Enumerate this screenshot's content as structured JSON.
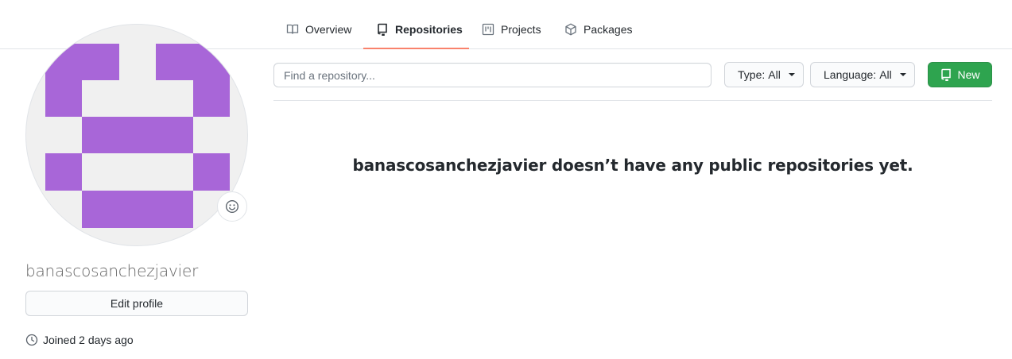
{
  "tabs": [
    {
      "label": "Overview",
      "icon": "book-icon",
      "selected": false
    },
    {
      "label": "Repositories",
      "icon": "repo-icon",
      "selected": true
    },
    {
      "label": "Projects",
      "icon": "project-icon",
      "selected": false
    },
    {
      "label": "Packages",
      "icon": "package-icon",
      "selected": false
    }
  ],
  "profile": {
    "username": "banascosanchezjavier",
    "edit_label": "Edit profile",
    "joined": "Joined 2 days ago",
    "avatar_color": "#a866d8"
  },
  "filters": {
    "search_placeholder": "Find a repository...",
    "type_prefix": "Type:",
    "type_value": "All",
    "language_prefix": "Language:",
    "language_value": "All",
    "new_label": "New"
  },
  "main": {
    "empty_message": "banascosanchezjavier doesn’t have any public repositories yet."
  },
  "colors": {
    "accent_tab": "#f9826c",
    "new_button": "#2ea44f"
  }
}
